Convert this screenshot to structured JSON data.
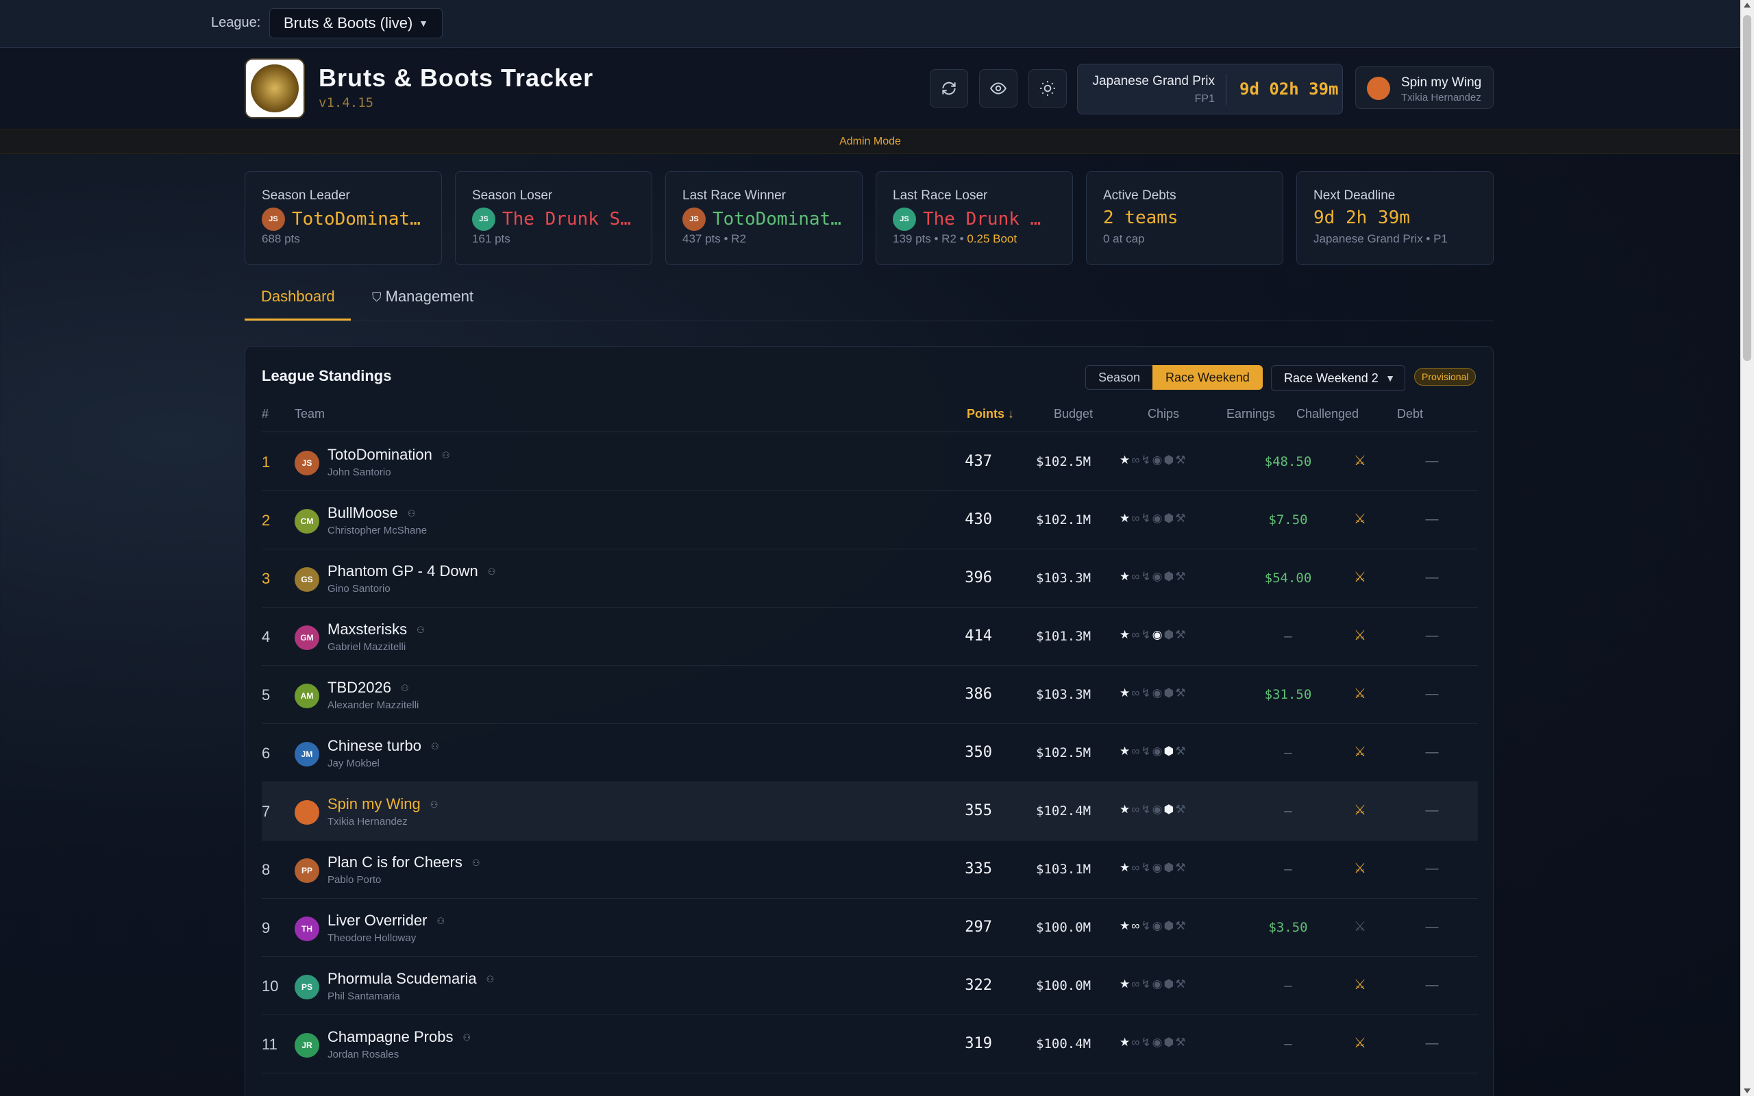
{
  "topbar": {
    "league_label": "League:",
    "league_value": "Bruts & Boots (live)"
  },
  "header": {
    "title": "Bruts & Boots Tracker",
    "version": "v1.4.15",
    "race_name": "Japanese Grand Prix",
    "race_session": "FP1",
    "race_countdown": "9d 02h 39m",
    "user_team": "Spin my Wing",
    "user_name": "Txikia Hernandez",
    "admin_mode": "Admin Mode"
  },
  "stats": [
    {
      "label": "Season Leader",
      "initials": "JS",
      "value": "TotoDominati…",
      "sub": "688 pts",
      "color": "#f0b232",
      "avatar_color": "#b35a2e"
    },
    {
      "label": "Season Loser",
      "initials": "JS",
      "value": "The Drunk Sa…",
      "sub": "161 pts",
      "color": "#e5484d",
      "avatar_color": "#2f9e7a"
    },
    {
      "label": "Last Race Winner",
      "initials": "JS",
      "value": "TotoDominati…",
      "sub": "437 pts • R2",
      "color": "#5fbf74",
      "avatar_color": "#b35a2e"
    },
    {
      "label": "Last Race Loser",
      "initials": "JS",
      "value": "The Drunk …",
      "sub": "139 pts • R2 •",
      "sub_extra": "0.25 Boot",
      "color": "#e5484d",
      "avatar_color": "#2f9e7a"
    },
    {
      "label": "Active Debts",
      "initials": "",
      "value": "2 teams",
      "sub": "0 at cap",
      "color": "#f0b232"
    },
    {
      "label": "Next Deadline",
      "initials": "",
      "value": "9d 2h 39m",
      "sub": "Japanese Grand Prix • P1",
      "color": "#f0b232"
    }
  ],
  "tabs": {
    "dashboard": "Dashboard",
    "management": "Management"
  },
  "standings": {
    "title": "League Standings",
    "toggle_season": "Season",
    "toggle_race": "Race Weekend",
    "round_select": "Race Weekend 2",
    "badge": "Provisional",
    "columns": {
      "rank": "#",
      "team": "Team",
      "points": "Points ↓",
      "budget": "Budget",
      "chips": "Chips",
      "earnings": "Earnings",
      "challenged": "Challenged",
      "debt": "Debt"
    },
    "rows": [
      {
        "rank": "1",
        "initials": "JS",
        "team": "TotoDomination",
        "owner": "John Santorio",
        "points": "437",
        "budget": "$102.5M",
        "earnings": "$48.50",
        "avatar_color": "#b35a2e"
      },
      {
        "rank": "2",
        "initials": "CM",
        "team": "BullMoose",
        "owner": "Christopher McShane",
        "points": "430",
        "budget": "$102.1M",
        "earnings": "$7.50",
        "avatar_color": "#7c9a2e"
      },
      {
        "rank": "3",
        "initials": "GS",
        "team": "Phantom GP - 4 Down",
        "owner": "Gino Santorio",
        "points": "396",
        "budget": "$103.3M",
        "earnings": "$54.00",
        "avatar_color": "#9a7a2e"
      },
      {
        "rank": "4",
        "initials": "GM",
        "team": "Maxsterisks",
        "owner": "Gabriel Mazzitelli",
        "points": "414",
        "budget": "$101.3M",
        "earnings": "—",
        "avatar_color": "#b0357a"
      },
      {
        "rank": "5",
        "initials": "AM",
        "team": "TBD2026",
        "owner": "Alexander Mazzitelli",
        "points": "386",
        "budget": "$103.3M",
        "earnings": "$31.50",
        "avatar_color": "#6e9a2e"
      },
      {
        "rank": "6",
        "initials": "JM",
        "team": "Chinese turbo",
        "owner": "Jay Mokbel",
        "points": "350",
        "budget": "$102.5M",
        "earnings": "—",
        "avatar_color": "#2e6ab0"
      },
      {
        "rank": "7",
        "initials": "",
        "team": "Spin my Wing",
        "owner": "Txikia Hernandez",
        "points": "355",
        "budget": "$102.4M",
        "earnings": "—",
        "avatar_color": "#d56a2c"
      },
      {
        "rank": "8",
        "initials": "PP",
        "team": "Plan C is for Cheers",
        "owner": "Pablo Porto",
        "points": "335",
        "budget": "$103.1M",
        "earnings": "—",
        "avatar_color": "#b3602e"
      },
      {
        "rank": "9",
        "initials": "TH",
        "team": "Liver Overrider",
        "owner": "Theodore Holloway",
        "points": "297",
        "budget": "$100.0M",
        "earnings": "$3.50",
        "avatar_color": "#9a2eb0"
      },
      {
        "rank": "10",
        "initials": "PS",
        "team": "Phormula Scudemaria",
        "owner": "Phil Santamaria",
        "points": "322",
        "budget": "$100.0M",
        "earnings": "—",
        "avatar_color": "#2e9a7a"
      },
      {
        "rank": "11",
        "initials": "JR",
        "team": "Champagne Probs",
        "owner": "Jordan Rosales",
        "points": "319",
        "budget": "$100.4M",
        "earnings": "—",
        "avatar_color": "#2e9a5a"
      }
    ],
    "debt_placeholder": "—"
  }
}
